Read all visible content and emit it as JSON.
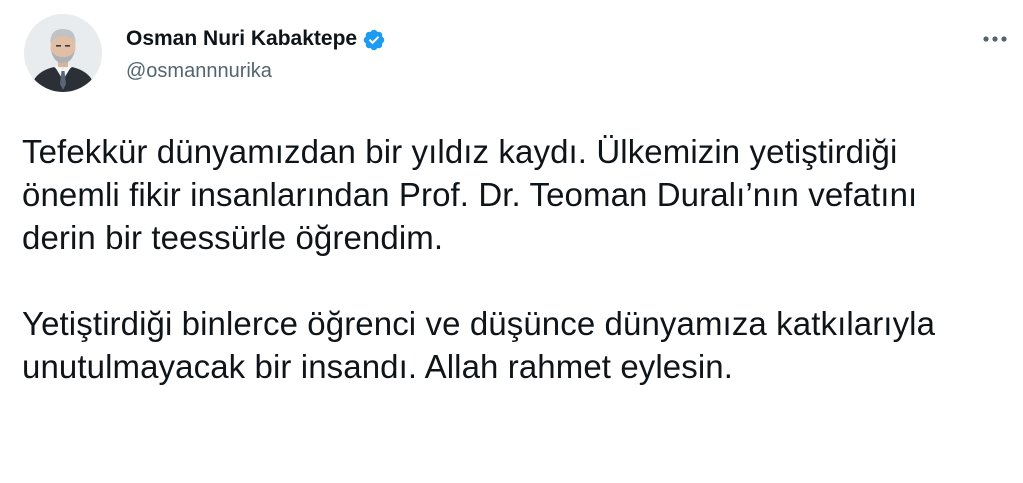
{
  "author": {
    "display_name": "Osman Nuri Kabaktepe",
    "handle": "@osmannnurika",
    "verified": true,
    "verified_icon": "verified-badge-icon",
    "avatar": "profile-photo"
  },
  "actions": {
    "more_icon": "more-horizontal-icon"
  },
  "tweet": {
    "paragraphs": [
      "Tefekkür dünyamızdan bir yıldız kaydı. Ülkemizin yetiştirdiği önemli fikir insanlarından Prof. Dr. Teoman Duralı’nın vefatını derin bir teessürle öğrendim.",
      "Yetiştirdiği binlerce öğrenci ve düşünce dünyamıza katkılarıyla unutulmayacak bir insandı. Allah rahmet eylesin."
    ]
  },
  "colors": {
    "text_primary": "#0f1419",
    "text_secondary": "#536471",
    "verified_blue": "#1d9bf0"
  }
}
